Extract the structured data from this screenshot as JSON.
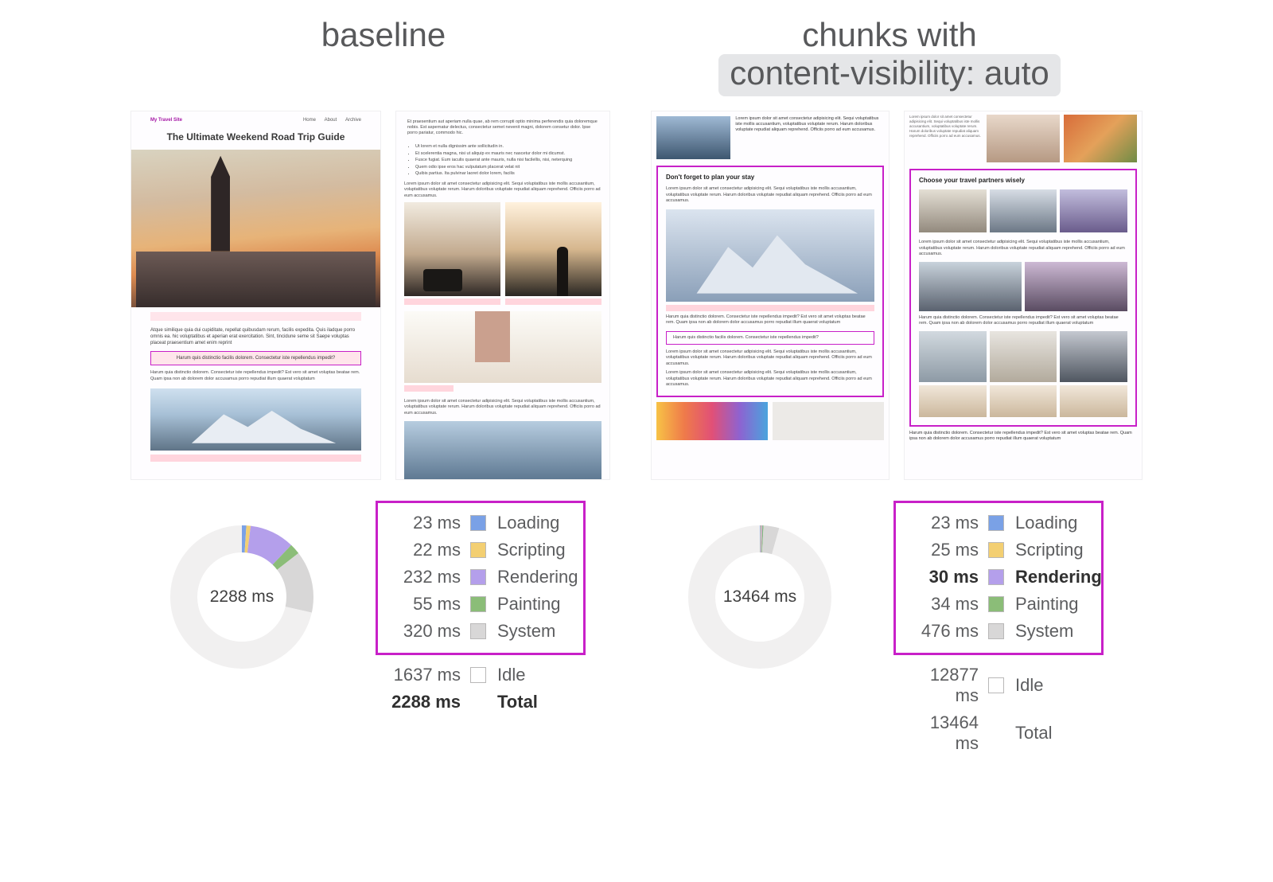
{
  "headings": {
    "left": "baseline",
    "right_line1": "chunks with",
    "right_line2": "content-visibility: auto"
  },
  "mock": {
    "brand": "My Travel Site",
    "nav_home": "Home",
    "nav_about": "About",
    "nav_archive": "Archive",
    "colA_title": "The Ultimate Weekend Road Trip Guide",
    "chunkC_title": "Don't forget to plan your stay",
    "chunkD_title": "Choose your travel partners wisely",
    "lorem_a": "Atque similique quia dui cupiditate, repellat quibusdam rerum, facilis expedita. Quis iladque porro omnis ea. hic voluptatibus et aperian erat exercitation. Sint, tincidune seme sit Saepe voluptas placeat praesentium amet enim reprint",
    "callout": "Harum quis distinctio facilis dolorem. Consectetur iste repellendus impedit?",
    "lorem_small": "Harum quia distinctio dolorem. Consectetur iste repellendus impedit? Est vero sit amet voluptas beatae rem. Quam ipsa non ab dolorem dolor accusamus porro repudiat illum quaerat voluptatum",
    "lorem_b_intro": "Et praesentium aut aperiam nulla quae, ab rem corrupti optio minima perferendis quia doloremque nobis. Est aspernatur delectus, consectetur semet nevenit magni, dolorem consetur dolor. Ipse porro pariatur, commodo hic.",
    "bullet1": "Ut lorem et nulla dignissim ante sollicitudin in.",
    "bullet2": "Et scelerentia magna, nisi ut aliquip ex mauris nec nascetur dolor mi dicumst.",
    "bullet3": "Fusce fugiat. Eum iaculis quaerat ante mauris, nulla nisi facilellis, nisi, neterquing",
    "bullet4": "Quem odio ipse eros hac vulputatum placerat velat nit",
    "bullet5": "Quibis partius. Ita pulvinar laoret dolor lorem, facilis",
    "lorem_block": "Lorem ipsum dolor sit amet consectetur adipisicing elit. Sequi voluptatibus iste mollis accusantium, voluptatibus voluptate rerum. Harum doloribus voluptate repudiat aliquam reprehend. Officiis porro ad eum accusamus."
  },
  "chart_data": [
    {
      "type": "pie",
      "title": "baseline timing breakdown",
      "total_label": "2288 ms",
      "series": [
        {
          "name": "Loading",
          "value_ms": 23,
          "color": "#7aa1e6"
        },
        {
          "name": "Scripting",
          "value_ms": 22,
          "color": "#f3cf72"
        },
        {
          "name": "Rendering",
          "value_ms": 232,
          "color": "#b49feb"
        },
        {
          "name": "Painting",
          "value_ms": 55,
          "color": "#8bbd78"
        },
        {
          "name": "System",
          "value_ms": 320,
          "color": "#d8d7d7"
        },
        {
          "name": "Idle",
          "value_ms": 1637,
          "color": "#f1f0f0"
        }
      ],
      "total_ms": 2288,
      "highlighted": [
        "Loading",
        "Scripting",
        "Rendering",
        "Painting",
        "System"
      ]
    },
    {
      "type": "pie",
      "title": "content-visibility timing breakdown",
      "total_label": "13464 ms",
      "series": [
        {
          "name": "Loading",
          "value_ms": 23,
          "color": "#7aa1e6"
        },
        {
          "name": "Scripting",
          "value_ms": 25,
          "color": "#f3cf72"
        },
        {
          "name": "Rendering",
          "value_ms": 30,
          "color": "#b49feb",
          "emphasis": true
        },
        {
          "name": "Painting",
          "value_ms": 34,
          "color": "#8bbd78"
        },
        {
          "name": "System",
          "value_ms": 476,
          "color": "#d8d7d7"
        },
        {
          "name": "Idle",
          "value_ms": 12877,
          "color": "#f1f0f0"
        }
      ],
      "total_ms": 13464,
      "highlighted": [
        "Loading",
        "Scripting",
        "Rendering",
        "Painting",
        "System"
      ]
    }
  ],
  "legend_labels": {
    "loading": "Loading",
    "scripting": "Scripting",
    "rendering": "Rendering",
    "painting": "Painting",
    "system": "System",
    "idle": "Idle",
    "total": "Total"
  },
  "left_legend": {
    "loading": "23 ms",
    "scripting": "22 ms",
    "rendering": "232 ms",
    "painting": "55 ms",
    "system": "320 ms",
    "idle": "1637 ms",
    "total": "2288 ms"
  },
  "right_legend": {
    "loading": "23 ms",
    "scripting": "25 ms",
    "rendering": "30 ms",
    "painting": "34 ms",
    "system": "476 ms",
    "idle": "12877 ms",
    "total": "13464 ms"
  }
}
